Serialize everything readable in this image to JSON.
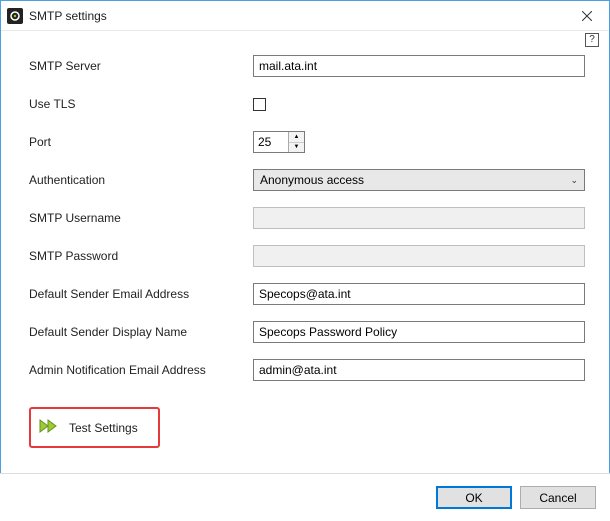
{
  "window": {
    "title": "SMTP settings"
  },
  "labels": {
    "smtp_server": "SMTP Server",
    "use_tls": "Use TLS",
    "port": "Port",
    "authentication": "Authentication",
    "smtp_username": "SMTP Username",
    "smtp_password": "SMTP Password",
    "default_sender_email": "Default Sender Email Address",
    "default_sender_name": "Default Sender Display Name",
    "admin_notification_email": "Admin Notification Email Address"
  },
  "values": {
    "smtp_server": "mail.ata.int",
    "use_tls": false,
    "port": "25",
    "authentication": "Anonymous access",
    "smtp_username": "",
    "smtp_password": "",
    "default_sender_email": "Specops@ata.int",
    "default_sender_name": "Specops Password Policy",
    "admin_notification_email": "admin@ata.int"
  },
  "actions": {
    "test_settings": "Test Settings",
    "ok": "OK",
    "cancel": "Cancel"
  }
}
